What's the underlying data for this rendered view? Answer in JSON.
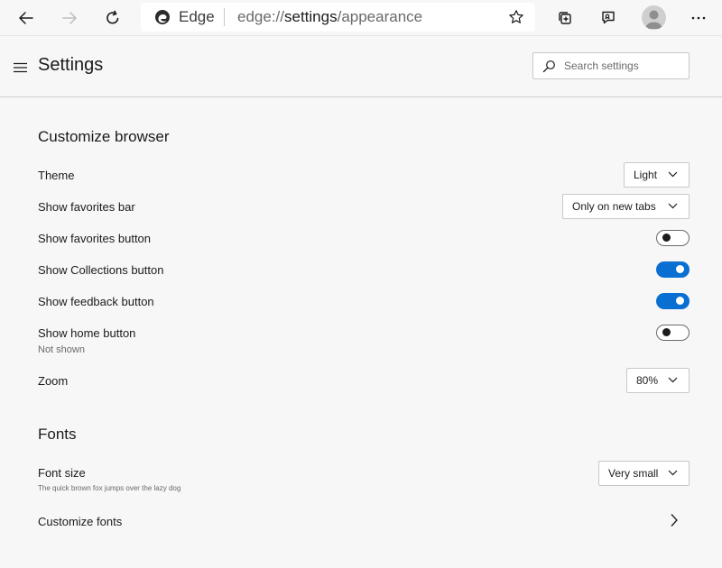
{
  "toolbar": {
    "brand": "Edge",
    "url_prefix": "edge://",
    "url_host": "settings",
    "url_path": "/appearance"
  },
  "header": {
    "title": "Settings",
    "search_placeholder": "Search settings"
  },
  "customize": {
    "title": "Customize browser",
    "theme": {
      "label": "Theme",
      "value": "Light"
    },
    "favorites_bar": {
      "label": "Show favorites bar",
      "value": "Only on new tabs"
    },
    "favorites_button": {
      "label": "Show favorites button",
      "on": false
    },
    "collections_button": {
      "label": "Show Collections button",
      "on": true
    },
    "feedback_button": {
      "label": "Show feedback button",
      "on": true
    },
    "home_button": {
      "label": "Show home button",
      "sub": "Not shown",
      "on": false
    },
    "zoom": {
      "label": "Zoom",
      "value": "80%"
    }
  },
  "fonts": {
    "title": "Fonts",
    "font_size": {
      "label": "Font size",
      "sample": "The quick brown fox jumps over the lazy dog",
      "value": "Very small"
    },
    "customize_fonts": {
      "label": "Customize fonts"
    }
  },
  "colors": {
    "accent": "#0a6fd2",
    "background": "#f7f7f7"
  }
}
